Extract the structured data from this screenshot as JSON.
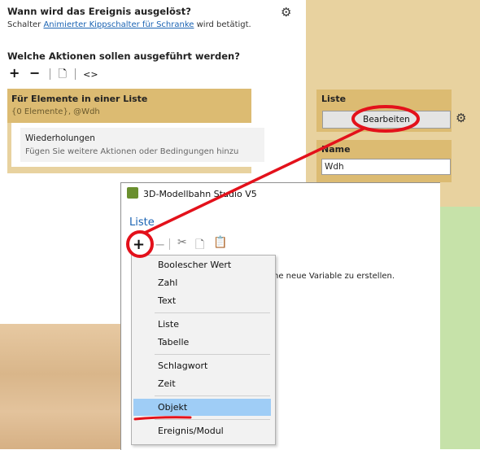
{
  "trigger": {
    "heading": "Wann wird das Ereignis ausgelöst?",
    "text_prefix": "Schalter",
    "link": "Animierter Kippschalter für Schranke",
    "text_suffix": "wird betätigt."
  },
  "actions": {
    "heading": "Welche Aktionen sollen ausgeführt werden?",
    "add_symbol": "+",
    "remove_symbol": "−",
    "code_symbol": "<>"
  },
  "list_block": {
    "title": "Für Elemente in einer Liste",
    "subtitle": "{0 Elemente}, @Wdh"
  },
  "repeat_block": {
    "title": "Wiederholungen",
    "hint": "Fügen Sie weitere Aktionen oder Bedingungen hinzu"
  },
  "sidebar": {
    "liste_label": "Liste",
    "edit_button": "Bearbeiten",
    "name_label": "Name",
    "name_value": "Wdh"
  },
  "dialog": {
    "title": "3D-Modellbahn Studio V5",
    "section": "Liste",
    "add_symbol": "+",
    "remove_symbol": "−",
    "hint_text": "ne neue Variable zu erstellen."
  },
  "menu": {
    "items": [
      "Boolescher Wert",
      "Zahl",
      "Text",
      "Liste",
      "Tabelle",
      "Schlagwort",
      "Zeit",
      "Objekt",
      "Ereignis/Modul"
    ],
    "selected": "Objekt"
  },
  "colors": {
    "accent_gold": "#dcbb72",
    "annotation_red": "#e3111b",
    "selection_blue": "#9fcdf6",
    "link_blue": "#1a63b3"
  }
}
